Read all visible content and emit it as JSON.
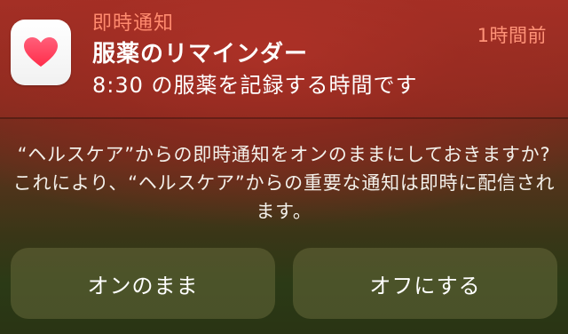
{
  "notification": {
    "app_name": "即時通知",
    "timestamp": "1時間前",
    "title": "服薬のリマインダー",
    "body": "8:30 の服薬を記録する時間です",
    "app_icon": "health-heart-icon",
    "colors": {
      "accent": "#ff8a6e",
      "icon_heart": "#ff2d55"
    }
  },
  "prompt": {
    "line1": "“ヘルスケア”からの即時通知をオンのままにしておきますか?",
    "line2": "これにより、“ヘルスケア”からの重要な通知は即時に配信され",
    "line3": "ます。"
  },
  "actions": {
    "keep_on_label": "オンのまま",
    "turn_off_label": "オフにする"
  }
}
